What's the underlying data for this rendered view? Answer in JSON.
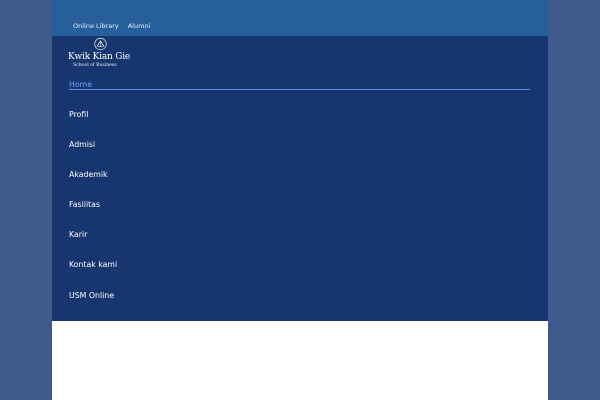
{
  "header": {
    "top_links": [
      {
        "label": "Online Library"
      },
      {
        "label": "Alumni"
      }
    ]
  },
  "logo": {
    "title": "Kwik Kian Gie",
    "subtitle": "School of Business"
  },
  "menu": {
    "items": [
      {
        "label": "Home"
      },
      {
        "label": "Profil"
      },
      {
        "label": "Admisi"
      },
      {
        "label": "Akademik"
      },
      {
        "label": "Fasilitas"
      },
      {
        "label": "Karir"
      },
      {
        "label": "Kontak kami"
      },
      {
        "label": "USM Online"
      }
    ]
  },
  "colors": {
    "topbar": "#275e9c",
    "nav_background": "#17366f",
    "active_link": "#64a6ff",
    "side_background": "#3f5b8c"
  }
}
